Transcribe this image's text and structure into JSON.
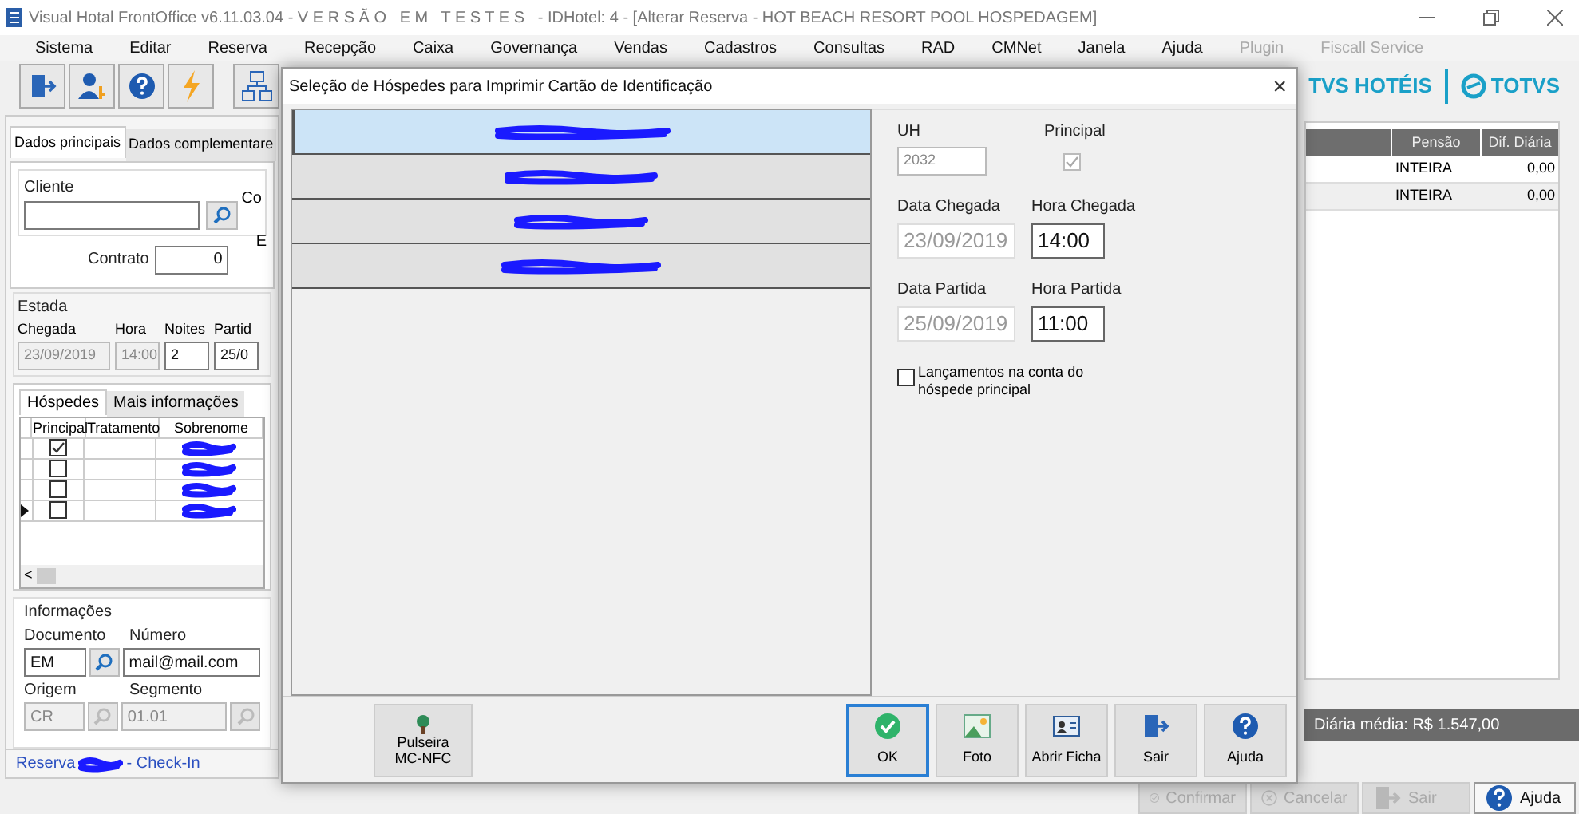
{
  "window": {
    "title": "Visual Hotal FrontOffice v6.11.03.04 - V E R S Ã O   E M   T E S T E S   - IDHotel: 4 - [Alterar Reserva - HOT BEACH RESORT POOL HOSPEDAGEM]"
  },
  "menu": [
    {
      "label": "Sistema",
      "disabled": false
    },
    {
      "label": "Editar",
      "disabled": false
    },
    {
      "label": "Reserva",
      "disabled": false
    },
    {
      "label": "Recepção",
      "disabled": false
    },
    {
      "label": "Caixa",
      "disabled": false
    },
    {
      "label": "Governança",
      "disabled": false
    },
    {
      "label": "Vendas",
      "disabled": false
    },
    {
      "label": "Cadastros",
      "disabled": false
    },
    {
      "label": "Consultas",
      "disabled": false
    },
    {
      "label": "RAD",
      "disabled": false
    },
    {
      "label": "CMNet",
      "disabled": false
    },
    {
      "label": "Janela",
      "disabled": false
    },
    {
      "label": "Ajuda",
      "disabled": false
    },
    {
      "label": "Plugin",
      "disabled": true
    },
    {
      "label": "Fiscall Service",
      "disabled": true
    }
  ],
  "brand": {
    "product": "TVS HOTÉIS",
    "company": "TOTVS"
  },
  "left_panel": {
    "tabs": [
      {
        "label": "Dados principais",
        "selected": true
      },
      {
        "label": "Dados complementare",
        "selected": false
      }
    ],
    "cliente": {
      "legend": "Cliente",
      "value_cut_label": "Co",
      "second_cut_label": "E"
    },
    "contrato": {
      "label": "Contrato",
      "value": "0"
    },
    "estada": {
      "legend": "Estada",
      "labels": [
        "Chegada",
        "Hora",
        "Noites",
        "Partid"
      ],
      "chegada": "23/09/2019",
      "hora": "14:00",
      "noites": "2",
      "partida": "25/0"
    },
    "guest_tabs": [
      {
        "label": "Hóspedes",
        "selected": true
      },
      {
        "label": "Mais informações",
        "selected": false
      }
    ],
    "guest_grid": {
      "columns": [
        "Principal",
        "Tratamento",
        "Sobrenome"
      ],
      "rows": [
        {
          "principal": true,
          "current": false
        },
        {
          "principal": false,
          "current": false
        },
        {
          "principal": false,
          "current": false
        },
        {
          "principal": false,
          "current": true
        }
      ]
    },
    "scroll_left": "<",
    "informacoes": {
      "legend": "Informações",
      "documento_label": "Documento",
      "documento": "EM",
      "numero_label": "Número",
      "numero": "mail@mail.com",
      "origem_label": "Origem",
      "origem": "CR",
      "segmento_label": "Segmento",
      "segmento": "01.01"
    },
    "footer": {
      "prefix": "Reserva",
      "suffix": "- Check-In"
    }
  },
  "rate_grid": {
    "columns": [
      "Pensão",
      "Dif. Diária"
    ],
    "rows": [
      [
        "INTEIRA",
        "0,00"
      ],
      [
        "INTEIRA",
        "0,00"
      ]
    ],
    "summary": "Diária média: R$ 1.547,00"
  },
  "app_buttons": [
    {
      "label": "Confirmar",
      "kind": "check",
      "disabled": true
    },
    {
      "label": "Cancelar",
      "kind": "cancel",
      "disabled": true
    },
    {
      "label": "Sair",
      "kind": "exit",
      "disabled": true
    },
    {
      "label": "Ajuda",
      "kind": "help",
      "disabled": false
    }
  ],
  "dialog": {
    "title": "Seleção de Hóspedes para Imprimir Cartão de Identificação",
    "close": "×",
    "guests": [
      {
        "selected": true
      },
      {
        "selected": false
      },
      {
        "selected": false
      },
      {
        "selected": false
      }
    ],
    "form": {
      "uh_label": "UH",
      "uh": "2032",
      "principal_label": "Principal",
      "principal": true,
      "data_chegada_label": "Data Chegada",
      "data_chegada": "23/09/2019",
      "hora_chegada_label": "Hora Chegada",
      "hora_chegada": "14:00",
      "data_partida_label": "Data Partida",
      "data_partida": "25/09/2019",
      "hora_partida_label": "Hora Partida",
      "hora_partida": "11:00",
      "lancamentos_label": "Lançamentos na conta do hóspede principal",
      "lancamentos": false
    },
    "left_button": {
      "label": "Pulseira MC-NFC"
    },
    "buttons": [
      {
        "label": "OK",
        "kind": "ok",
        "focused": true
      },
      {
        "label": "Foto",
        "kind": "photo",
        "focused": false
      },
      {
        "label": "Abrir Ficha",
        "kind": "card",
        "focused": false
      },
      {
        "label": "Sair",
        "kind": "exit",
        "focused": false
      },
      {
        "label": "Ajuda",
        "kind": "help",
        "focused": false
      }
    ]
  }
}
